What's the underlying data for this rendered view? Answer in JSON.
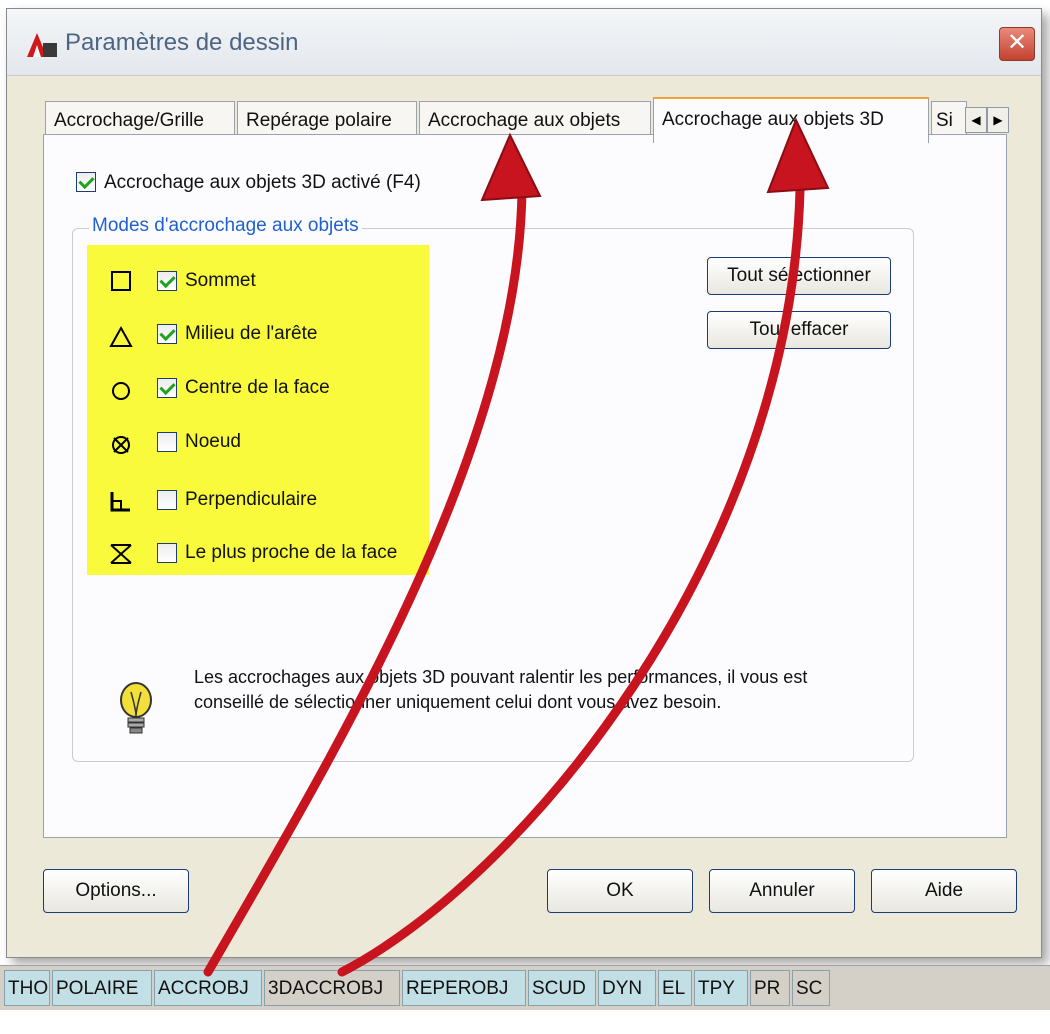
{
  "window": {
    "title": "Paramètres de dessin",
    "close_glyph": "✕"
  },
  "tabs": [
    {
      "label": "Accrochage/Grille",
      "active": false
    },
    {
      "label": "Repérage polaire",
      "active": false
    },
    {
      "label": "Accrochage aux objets",
      "active": false
    },
    {
      "label": "Accrochage aux objets 3D",
      "active": true
    },
    {
      "label": "Si",
      "active": false
    }
  ],
  "tab_scroll": {
    "left": "◀",
    "right": "▶"
  },
  "osnap3d_enable": {
    "label": "Accrochage aux objets 3D activé (F4)",
    "checked": true
  },
  "modes": {
    "legend": "Modes d'accrochage aux objets",
    "items": [
      {
        "label": "Sommet",
        "checked": true,
        "icon": "square-icon"
      },
      {
        "label": "Milieu de l'arête",
        "checked": true,
        "icon": "triangle-icon"
      },
      {
        "label": "Centre de la face",
        "checked": true,
        "icon": "circle-icon"
      },
      {
        "label": "Noeud",
        "checked": false,
        "icon": "node-icon"
      },
      {
        "label": "Perpendiculaire",
        "checked": false,
        "icon": "perpendicular-icon"
      },
      {
        "label": "Le plus proche de la face",
        "checked": false,
        "icon": "hourglass-icon"
      }
    ],
    "highlight_color": "#fafa3c"
  },
  "buttons": {
    "select_all": "Tout sélectionner",
    "clear_all": "Tout effacer",
    "options": "Options...",
    "ok": "OK",
    "cancel": "Annuler",
    "help": "Aide"
  },
  "info": {
    "icon": "lightbulb-icon",
    "text": "Les accrochages aux objets 3D pouvant ralentir les performances, il vous est conseillé de sélectionner uniquement celui dont vous avez besoin."
  },
  "statusbar": [
    {
      "label": "THO",
      "on": true
    },
    {
      "label": "POLAIRE",
      "on": true
    },
    {
      "label": "ACCROBJ",
      "on": true
    },
    {
      "label": "3DACCROBJ",
      "on": false
    },
    {
      "label": "REPEROBJ",
      "on": true
    },
    {
      "label": "SCUD",
      "on": true
    },
    {
      "label": "DYN",
      "on": true
    },
    {
      "label": "EL",
      "on": true
    },
    {
      "label": "TPY",
      "on": true
    },
    {
      "label": "PR",
      "on": false
    },
    {
      "label": "SC",
      "on": false
    }
  ],
  "colors": {
    "accent_arrow": "#c8141e",
    "legend_blue": "#2160d0"
  }
}
